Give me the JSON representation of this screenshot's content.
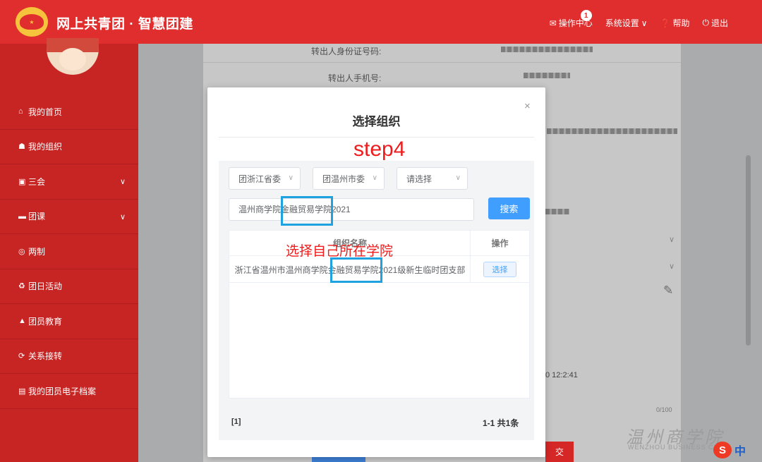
{
  "header": {
    "title": "网上共青团 · 智慧团建",
    "nav": {
      "operations": "操作中心",
      "operations_badge": "1",
      "settings": "系统设置",
      "help": "帮助",
      "logout": "退出"
    }
  },
  "sidebar": {
    "items": [
      {
        "label": "我的首页",
        "icon": "home-icon"
      },
      {
        "label": "我的组织",
        "icon": "group-icon"
      },
      {
        "label": "三会",
        "icon": "calendar-icon",
        "expandable": true
      },
      {
        "label": "团课",
        "icon": "folder-icon",
        "expandable": true
      },
      {
        "label": "两制",
        "icon": "circle-icon"
      },
      {
        "label": "团日活动",
        "icon": "recycle-icon"
      },
      {
        "label": "团员教育",
        "icon": "graduation-cap-icon"
      },
      {
        "label": "关系接转",
        "icon": "refresh-icon"
      },
      {
        "label": "我的团员电子档案",
        "icon": "file-icon"
      }
    ]
  },
  "background_form": {
    "id_label": "转出人身份证号码:",
    "phone_label": "转出人手机号:",
    "timestamp_fragment": "0 12:2:41",
    "counter": "0/100",
    "submit_fragment": "交"
  },
  "modal": {
    "title": "选择组织",
    "close": "×",
    "filters": {
      "province": "团浙江省委",
      "city": "团温州市委",
      "third": "请选择"
    },
    "search": {
      "value": "温州商学院金融贸易学院2021",
      "button": "搜索"
    },
    "table": {
      "columns": [
        "组织名称",
        "操作"
      ],
      "rows": [
        {
          "name": "浙江省温州市温州商学院金融贸易学院2021级新生临时团支部",
          "action": "选择"
        }
      ]
    },
    "pagination": {
      "pages": "[1]",
      "summary": "1-1  共1条"
    }
  },
  "annotations": {
    "step": "step4",
    "instruction": "选择自己所在学院",
    "color": "#ee1c1c",
    "box_color": "#1ea2e0"
  },
  "watermark": {
    "name": "温州商学院",
    "sub": "WENZHOU BUSINESS C",
    "ime_logo": "S",
    "ime_lang": "中"
  }
}
